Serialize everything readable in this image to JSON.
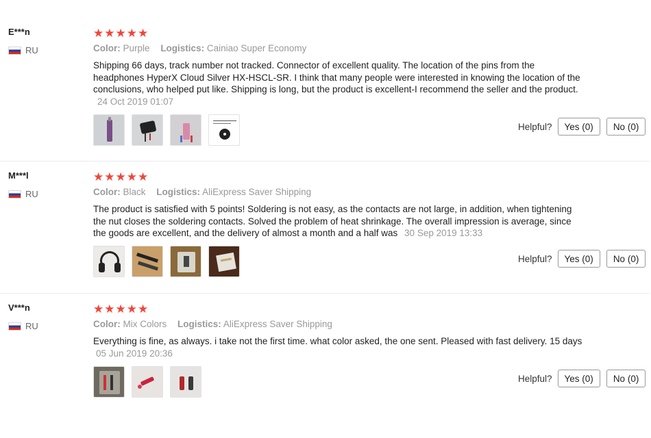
{
  "rating_stars": 5,
  "star_color": "#f0463a",
  "helpful_label": "Helpful?",
  "reviews": [
    {
      "user": "E***n",
      "country": "RU",
      "color_label": "Color:",
      "color_value": "Purple",
      "logistics_label": "Logistics:",
      "logistics_value": "Cainiao Super Economy",
      "text": "Shipping 66 days, track number not tracked. Connector of excellent quality. The location of the pins from the headphones HyperX Cloud Silver HX-HSCL-SR. I think that many people were interested in knowing the location of the conclusions, who helped put like. Shipping is long, but the product is excellent-I recommend the seller and the product.",
      "date": "24 Oct 2019 01:07",
      "photos": [
        "photo-connector-cable",
        "photo-black-plug",
        "photo-pink-connector",
        "photo-pinout-diagram"
      ],
      "yes_label": "Yes (0)",
      "no_label": "No (0)"
    },
    {
      "user": "M***l",
      "country": "RU",
      "color_label": "Color:",
      "color_value": "Black",
      "logistics_label": "Logistics:",
      "logistics_value": "AliExpress Saver Shipping",
      "text": "The product is satisfied with 5 points! Soldering is not easy, as the contacts are not large, in addition, when tightening the nut closes the soldering contacts. Solved the problem of heat shrinkage. The overall impression is average, since the goods are excellent, and the delivery of almost a month and a half was",
      "date": "30 Sep 2019 13:33",
      "photos": [
        "photo-headphones",
        "photo-connectors-table",
        "photo-connector-package",
        "photo-parcel-hand"
      ],
      "yes_label": "Yes (0)",
      "no_label": "No (0)"
    },
    {
      "user": "V***n",
      "country": "RU",
      "color_label": "Color:",
      "color_value": "Mix Colors",
      "logistics_label": "Logistics:",
      "logistics_value": "AliExpress Saver Shipping",
      "text": "Everything is fine, as always. i take not the first time. what color asked, the one sent. Pleased with fast delivery. 15 days",
      "date": "05 Jun 2019 20:36",
      "photos": [
        "photo-connectors-bag",
        "photo-red-connectors",
        "photo-connectors-pair"
      ],
      "yes_label": "Yes (0)",
      "no_label": "No (0)"
    }
  ]
}
